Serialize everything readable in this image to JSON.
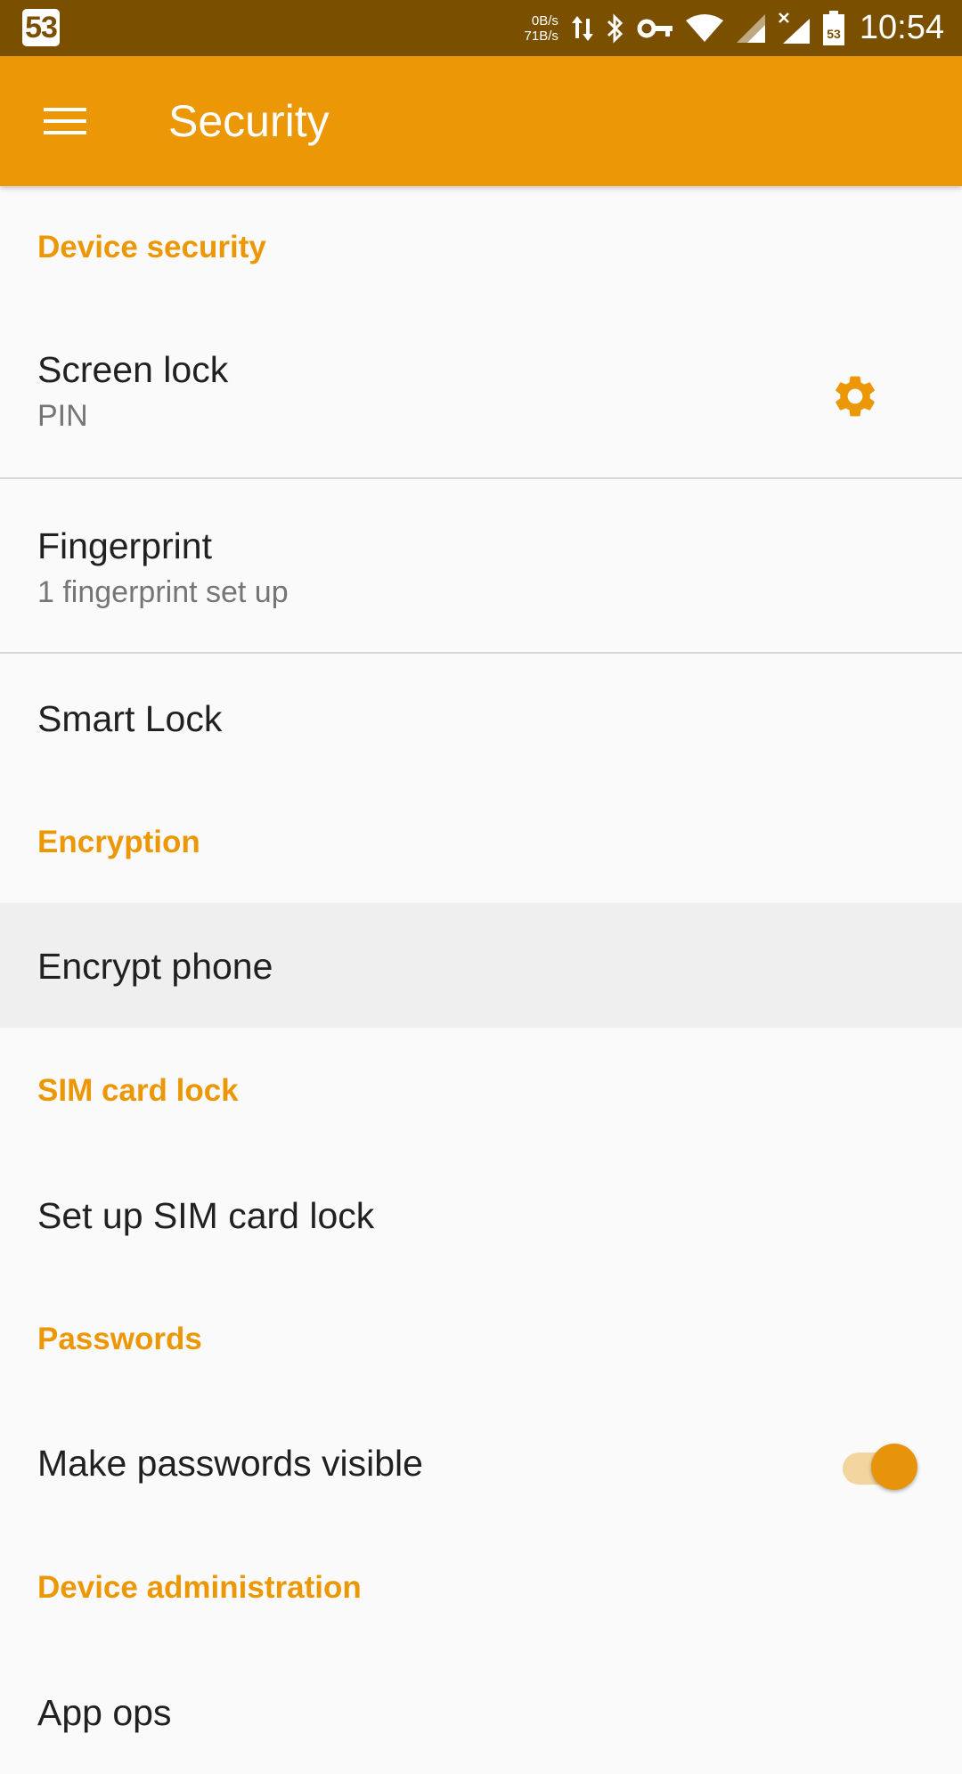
{
  "status_bar": {
    "notification_badge": "53",
    "speed_up": "0B/s",
    "speed_down": "71B/s",
    "time": "10:54",
    "icons": [
      "data-transfer-icon",
      "bluetooth-icon",
      "vpn-key-icon",
      "wifi-icon",
      "signal-icon",
      "no-signal-icon",
      "battery-icon"
    ]
  },
  "app_bar": {
    "title": "Security",
    "menu_icon": "hamburger-menu-icon",
    "color": "#eb9706"
  },
  "sections": {
    "device_security": {
      "header": "Device security",
      "screen_lock": {
        "title": "Screen lock",
        "summary": "PIN",
        "action_icon": "gear-icon"
      },
      "fingerprint": {
        "title": "Fingerprint",
        "summary": "1 fingerprint set up"
      },
      "smart_lock": {
        "title": "Smart Lock"
      }
    },
    "encryption": {
      "header": "Encryption",
      "encrypt_phone": {
        "title": "Encrypt phone"
      }
    },
    "sim_card_lock": {
      "header": "SIM card lock",
      "setup": {
        "title": "Set up SIM card lock"
      }
    },
    "passwords": {
      "header": "Passwords",
      "visible": {
        "title": "Make passwords visible",
        "enabled": true
      }
    },
    "device_admin": {
      "header": "Device administration",
      "app_ops": {
        "title": "App ops"
      }
    }
  },
  "colors": {
    "accent": "#eb9706",
    "status_bar": "#7a5000",
    "background": "#fafafa",
    "pressed_row": "#efefef"
  }
}
